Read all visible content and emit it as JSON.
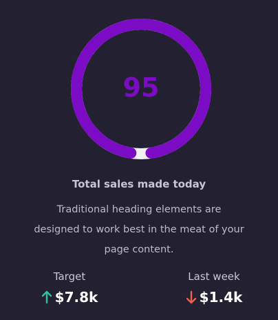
{
  "gauge": {
    "value": "95",
    "percent": 0.95,
    "color": "#7b0bc4",
    "track_color": "#f2f2f4"
  },
  "card": {
    "title": "Total sales made today",
    "description": "Traditional heading elements are designed to work best in the meat of your page content."
  },
  "stats": {
    "target": {
      "label": "Target",
      "value": "$7.8k",
      "trend_icon": "arrow-up-icon",
      "trend_color": "#2fc59a"
    },
    "last_week": {
      "label": "Last week",
      "value": "$1.4k",
      "trend_icon": "arrow-down-icon",
      "trend_color": "#f0604e"
    }
  }
}
